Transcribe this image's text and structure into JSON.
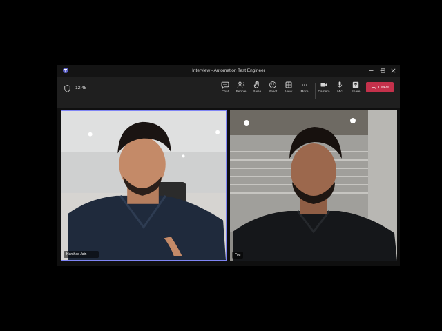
{
  "window": {
    "title": "Interview - Automation Test Engineer"
  },
  "toolbar": {
    "timer": "12:45",
    "people_count": "2",
    "buttons": [
      {
        "id": "chat",
        "label": "Chat",
        "icon": "chat-icon"
      },
      {
        "id": "people",
        "label": "People",
        "icon": "people-icon"
      },
      {
        "id": "raise",
        "label": "Raise",
        "icon": "hand-icon"
      },
      {
        "id": "react",
        "label": "React",
        "icon": "smiley-icon"
      },
      {
        "id": "view",
        "label": "View",
        "icon": "grid-icon"
      },
      {
        "id": "more",
        "label": "More",
        "icon": "more-icon"
      },
      {
        "id": "camera",
        "label": "Camera",
        "icon": "camera-icon"
      },
      {
        "id": "mic",
        "label": "Mic",
        "icon": "mic-icon"
      },
      {
        "id": "share",
        "label": "Share",
        "icon": "share-icon"
      }
    ],
    "leave_label": "Leave"
  },
  "participants": [
    {
      "name": "Harshad Jain",
      "more": "···"
    },
    {
      "name": "You"
    }
  ],
  "colors": {
    "leave": "#c4314b",
    "active_speaker_border": "#7f85f5"
  }
}
